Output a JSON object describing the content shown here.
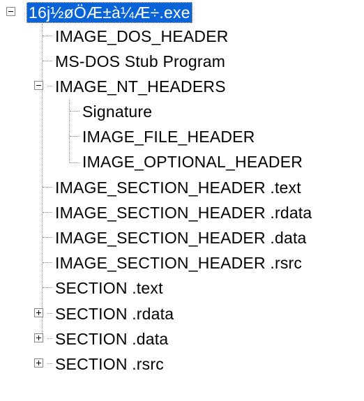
{
  "tree": {
    "root": {
      "label": "16j½øÖÆ±à¼­Æ÷.exe",
      "expanded": true,
      "selected": true,
      "children": [
        {
          "label": "IMAGE_DOS_HEADER"
        },
        {
          "label": "MS-DOS Stub Program"
        },
        {
          "label": "IMAGE_NT_HEADERS",
          "expanded": true,
          "children": [
            {
              "label": "Signature"
            },
            {
              "label": "IMAGE_FILE_HEADER"
            },
            {
              "label": "IMAGE_OPTIONAL_HEADER"
            }
          ]
        },
        {
          "label": "IMAGE_SECTION_HEADER .text"
        },
        {
          "label": "IMAGE_SECTION_HEADER .rdata"
        },
        {
          "label": "IMAGE_SECTION_HEADER .data"
        },
        {
          "label": "IMAGE_SECTION_HEADER .rsrc"
        },
        {
          "label": "SECTION .text"
        },
        {
          "label": "SECTION .rdata",
          "expanded": false
        },
        {
          "label": "SECTION .data",
          "expanded": false
        },
        {
          "label": "SECTION .rsrc",
          "expanded": false
        }
      ]
    }
  },
  "colors": {
    "selection": "#0a64d8",
    "selection_text": "#ffffff",
    "focus_outline": "#f3c17a",
    "connector": "#888888"
  }
}
